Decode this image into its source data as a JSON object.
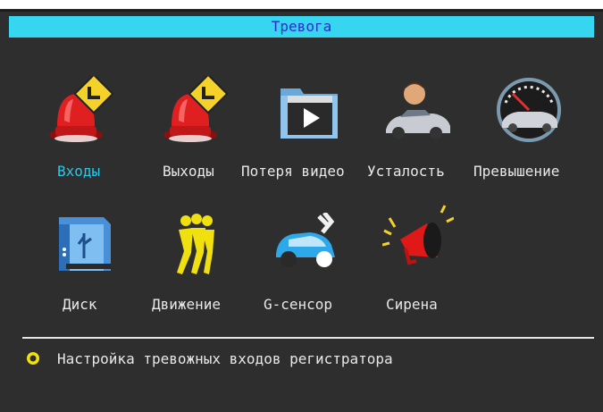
{
  "window": {
    "title": "Тревога"
  },
  "menu": {
    "items": [
      {
        "label": "Входы",
        "icon": "alarm-input-icon",
        "selected": true
      },
      {
        "label": "Выходы",
        "icon": "alarm-output-icon",
        "selected": false
      },
      {
        "label": "Потеря видео",
        "icon": "video-loss-icon",
        "selected": false
      },
      {
        "label": "Усталость",
        "icon": "fatigue-icon",
        "selected": false
      },
      {
        "label": "Превышение",
        "icon": "speeding-icon",
        "selected": false
      },
      {
        "label": "Диск",
        "icon": "disk-icon",
        "selected": false
      },
      {
        "label": "Движение",
        "icon": "motion-icon",
        "selected": false
      },
      {
        "label": "G-сенсор",
        "icon": "g-sensor-icon",
        "selected": false
      },
      {
        "label": "Сирена",
        "icon": "siren-icon",
        "selected": false
      }
    ]
  },
  "help": {
    "text": "Настройка тревожных входов регистратора"
  },
  "colors": {
    "title_bar": "#37d6f0",
    "title_text": "#2b2bd0",
    "selected": "#28c8e8",
    "background": "#2e2e2e"
  }
}
